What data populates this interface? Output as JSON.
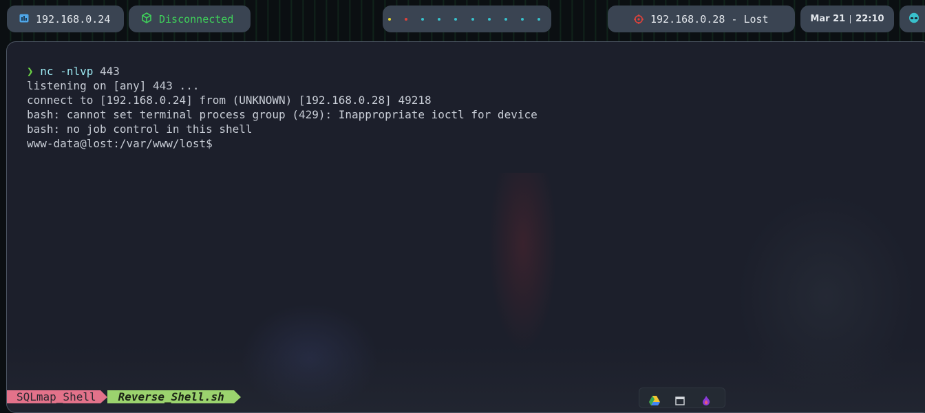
{
  "topbar": {
    "local_ip": "192.168.0.24",
    "vpn_status": "Disconnected",
    "target": "192.168.0.28 - Lost",
    "date": "Mar 21",
    "time": "22:10",
    "workspaces": [
      {
        "color": "#e7d534"
      },
      {
        "color": "#e0423b"
      },
      {
        "color": "#39c1cc"
      },
      {
        "color": "#39c1cc"
      },
      {
        "color": "#39c1cc"
      },
      {
        "color": "#39c1cc"
      },
      {
        "color": "#39c1cc"
      },
      {
        "color": "#39c1cc"
      },
      {
        "color": "#39c1cc"
      },
      {
        "color": "#39c1cc"
      }
    ]
  },
  "terminal": {
    "prompt_symbol": "❯",
    "command": "nc -nlvp",
    "command_arg": "443",
    "output": [
      "listening on [any] 443 ...",
      "connect to [192.168.0.24] from (UNKNOWN) [192.168.0.28] 49218",
      "bash: cannot set terminal process group (429): Inappropriate ioctl for device",
      "bash: no job control in this shell",
      "www-data@lost:/var/www/lost$"
    ]
  },
  "statusbar": {
    "tabs": [
      "SQLmap_Shell",
      "Reverse_Shell.sh"
    ]
  },
  "colors": {
    "accent_green": "#6bd345",
    "tab_pink": "#e3728a",
    "tab_green": "#9bd36e",
    "terminal_bg": "#1c1f2b"
  }
}
